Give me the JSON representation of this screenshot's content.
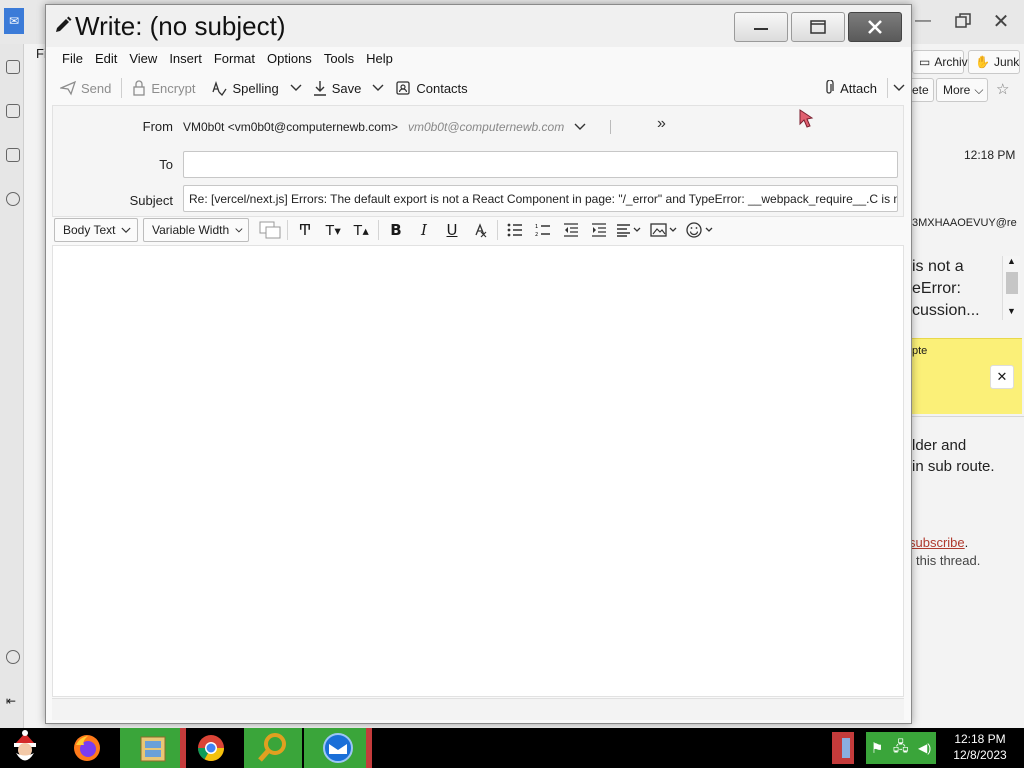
{
  "compose_window": {
    "title": "Write: (no subject)",
    "window_buttons": [
      "minimize",
      "maximize",
      "close"
    ]
  },
  "menubar": [
    "File",
    "Edit",
    "View",
    "Insert",
    "Format",
    "Options",
    "Tools",
    "Help"
  ],
  "toolbar": {
    "send": "Send",
    "encrypt": "Encrypt",
    "spelling": "Spelling",
    "save": "Save",
    "contacts": "Contacts",
    "attach": "Attach"
  },
  "headers": {
    "from_label": "From",
    "from_identity": "VM0b0t <vm0b0t@computernewb.com>",
    "from_email": "vm0b0t@computernewb.com",
    "to_label": "To",
    "to_value": "",
    "subject_label": "Subject",
    "subject_value": "Re: [vercel/next.js] Errors: The default export is not a React Component in page: \"/_error\" and TypeError: __webpack_require__.C is not a"
  },
  "format_bar": {
    "paragraph_format": "Body Text",
    "font": "Variable Width"
  },
  "background_window": {
    "archive": "Archive",
    "junk": "Junk",
    "delete_partial": "ete",
    "more": "More",
    "time": "12:18 PM",
    "message_id_partial": "3MXHAAOEVUY@re",
    "preview_lines": [
      "is not a",
      "eError:",
      "cussion..."
    ],
    "note_label": "pte",
    "body_lines": [
      "lder and",
      "in sub route."
    ],
    "unsubscribe_link": "subscribe",
    "thread_text": "this thread."
  },
  "taskbar": {
    "time": "12:18 PM",
    "date": "12/8/2023"
  },
  "colors": {
    "taskbar_bg": "#000000",
    "taskbar_active": "#3aa53a",
    "note_bg": "#fbf078",
    "link": "#b03a2e"
  }
}
